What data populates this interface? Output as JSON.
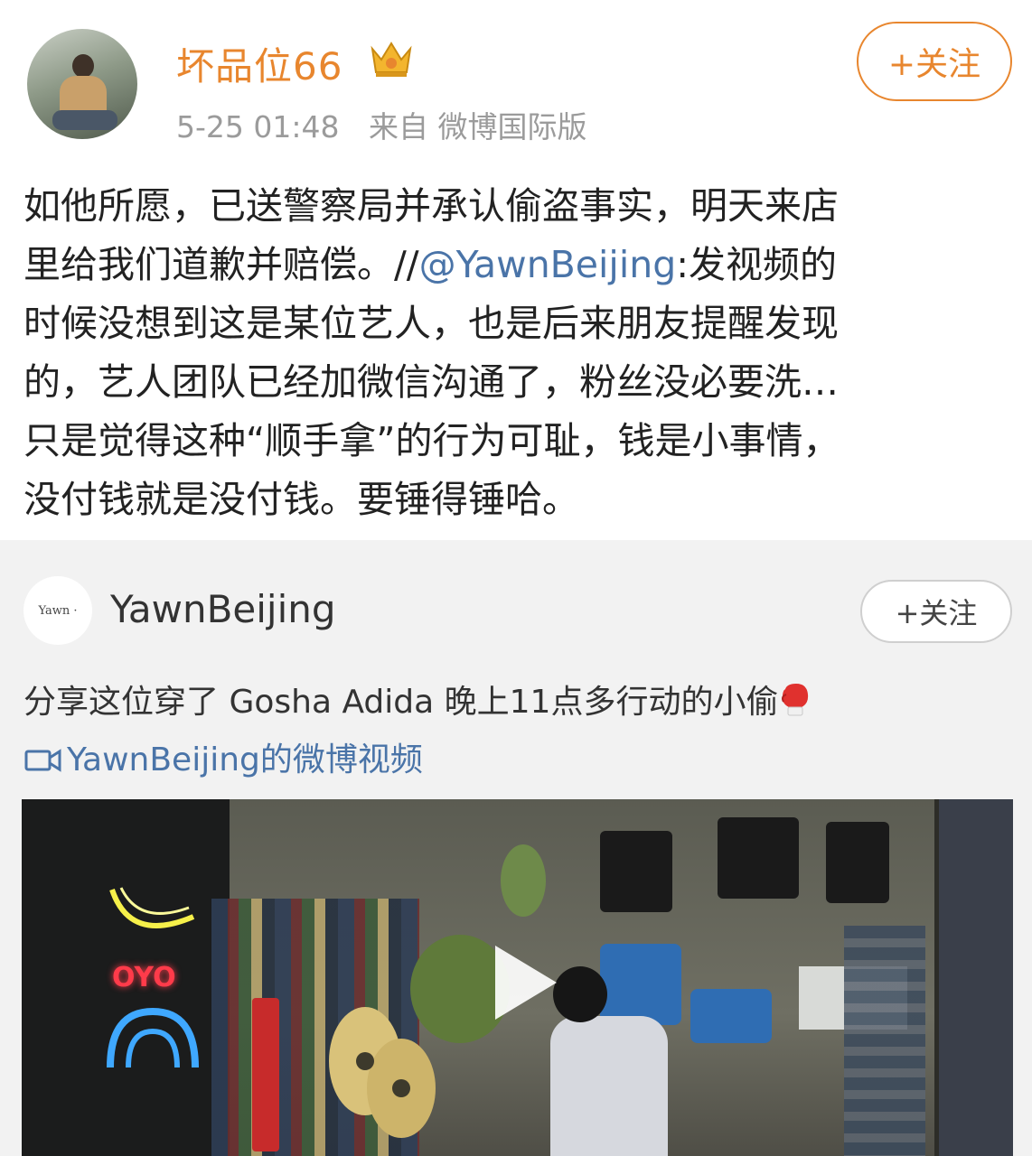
{
  "post": {
    "username": "坏品位66",
    "time": "5-25 01:48",
    "source": "来自 微博国际版",
    "follow_label": "+关注",
    "text_lines": [
      [
        "如他所愿，已送警察局并承认偷盗事实，明天来店",
        "",
        ""
      ],
      [
        "里给我们道歉并赔偿。//",
        "@YawnBeijing",
        ":发视频的"
      ],
      [
        "时候没想到这是某位艺人，也是后来朋友提醒发现",
        "",
        ""
      ],
      [
        "的，艺人团队已经加微信沟通了，粉丝没必要洗…",
        "",
        ""
      ],
      [
        "只是觉得这种“顺手拿”的行为可耻，钱是小事情，",
        "",
        ""
      ],
      [
        "没付钱就是没付钱。要锤得锤哈。",
        "",
        ""
      ]
    ]
  },
  "repost": {
    "avatar_text": "Yawn ·",
    "name": "YawnBeijing",
    "follow_label": "+关注",
    "text": "分享这位穿了 Gosha Adida 晚上11点多行动的小偷",
    "video_link": "YawnBeijing的微博视频"
  },
  "video": {
    "neon_sign": "OYO"
  },
  "colors": {
    "username": "#e8862e",
    "link": "#4a74a8",
    "repost_bg": "#f2f2f2"
  },
  "icons": {
    "verified": "crown-icon",
    "emoji": "boxing-glove-icon",
    "video_link": "video-camera-icon",
    "play": "play-icon"
  }
}
